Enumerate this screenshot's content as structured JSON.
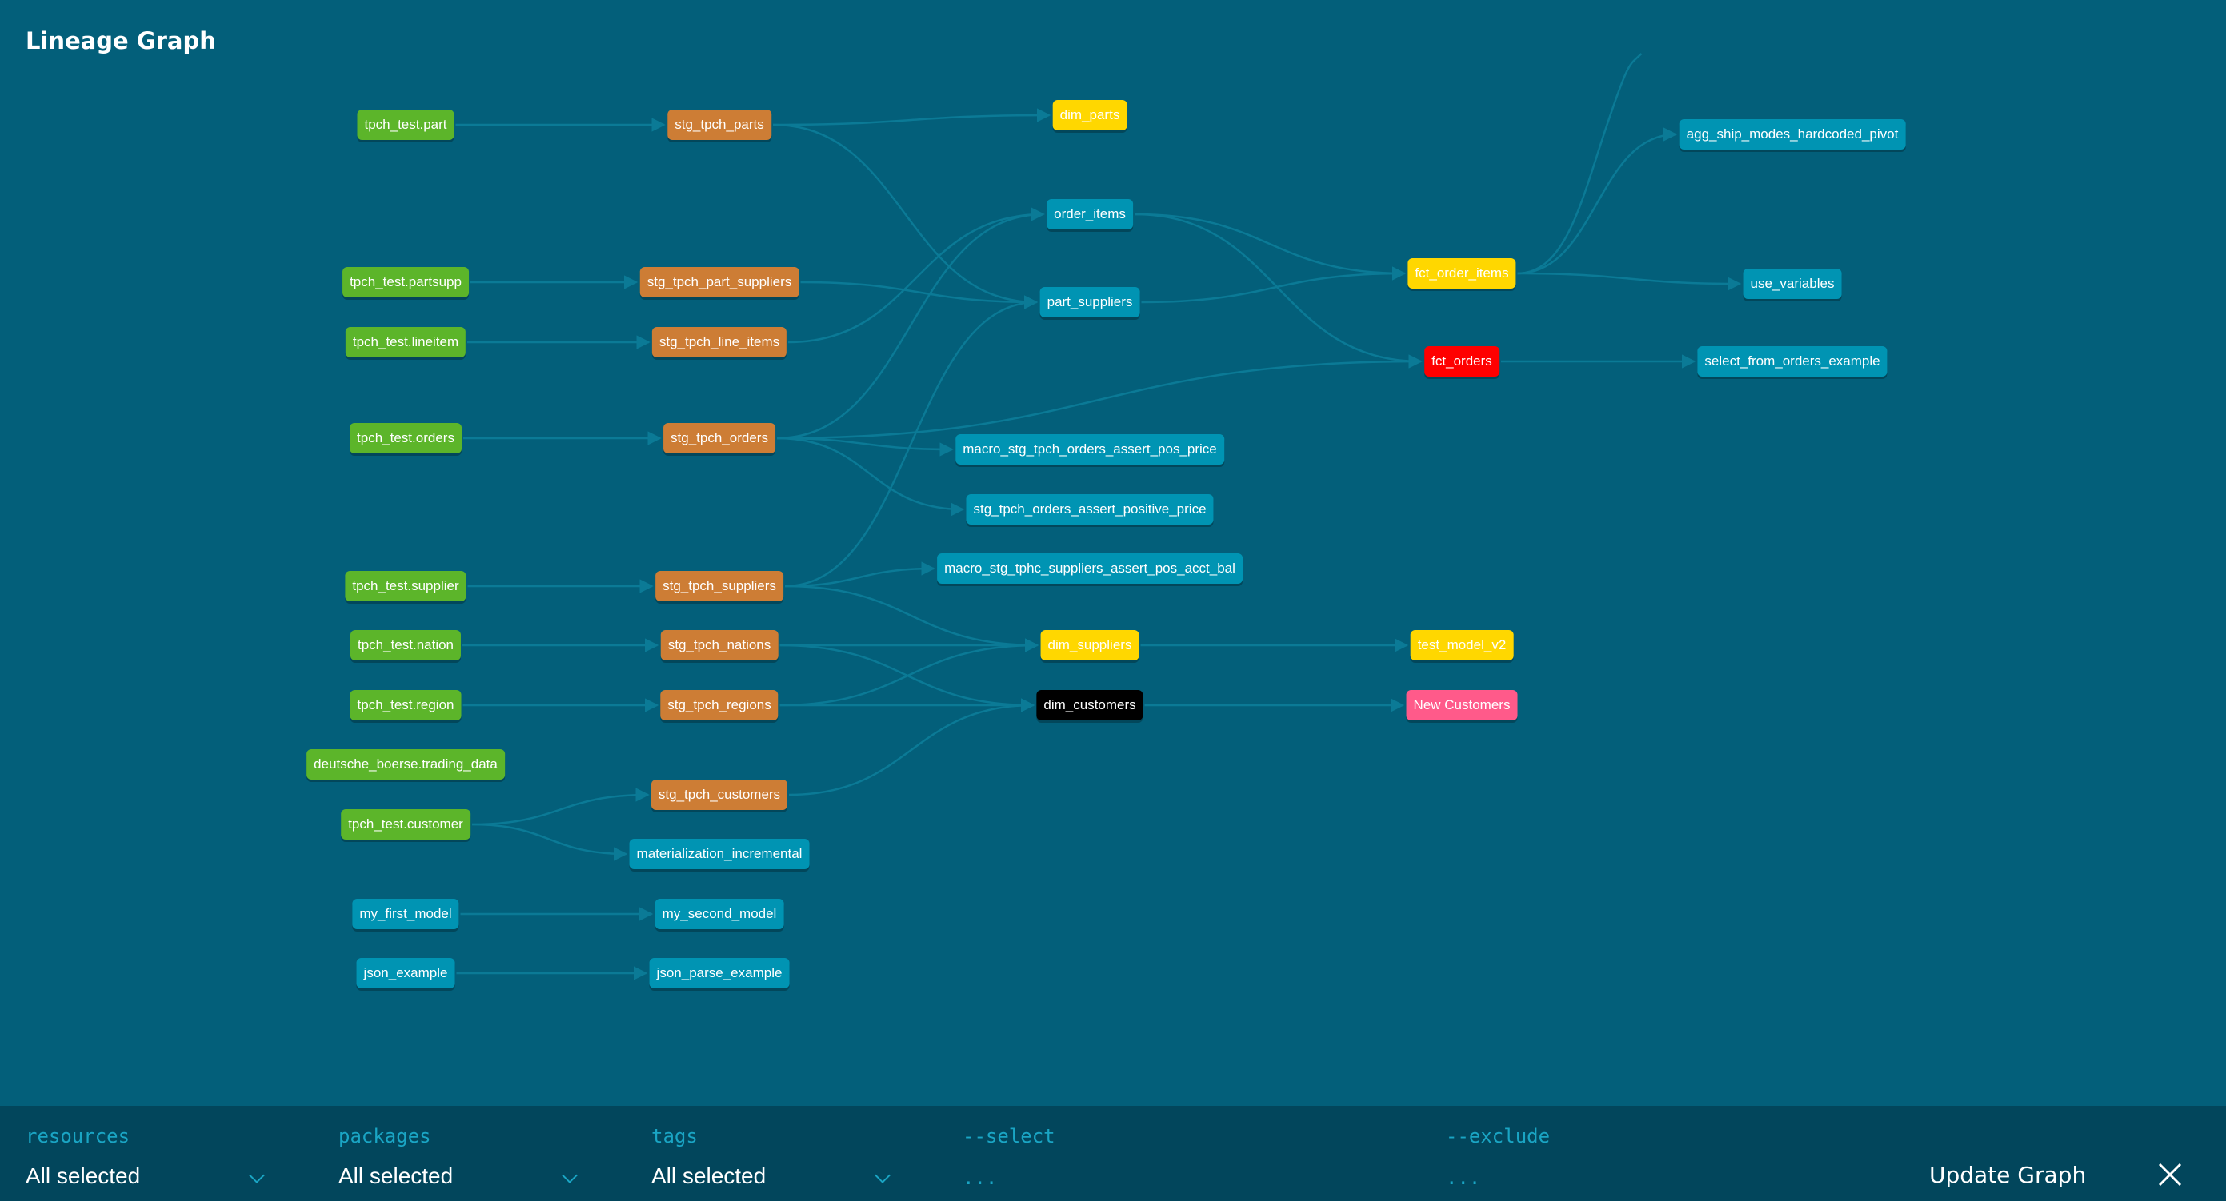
{
  "title": "Lineage Graph",
  "colors": {
    "background": "#035f7a",
    "toolbar": "#02465c",
    "edge": "#0b7a96",
    "source": "#5cb52a",
    "staging": "#cd7d35",
    "model": "#0094b3",
    "mart": "#ffd700",
    "highlight_red": "#ff0000",
    "selected_black": "#000000",
    "exposure_pink": "#ff5a8a"
  },
  "nodes": [
    {
      "id": "tpch_test.part",
      "label": "tpch_test.part",
      "type": "source"
    },
    {
      "id": "stg_tpch_parts",
      "label": "stg_tpch_parts",
      "type": "staging"
    },
    {
      "id": "dim_parts",
      "label": "dim_parts",
      "type": "mart"
    },
    {
      "id": "order_items",
      "label": "order_items",
      "type": "model"
    },
    {
      "id": "part_suppliers",
      "label": "part_suppliers",
      "type": "model"
    },
    {
      "id": "fct_order_items",
      "label": "fct_order_items",
      "type": "mart"
    },
    {
      "id": "fct_orders",
      "label": "fct_orders",
      "type": "highlight_red"
    },
    {
      "id": "agg_ship_modes_hardcoded_pivot",
      "label": "agg_ship_modes_hardcoded_pivot",
      "type": "model"
    },
    {
      "id": "use_variables",
      "label": "use_variables",
      "type": "model"
    },
    {
      "id": "select_from_orders_example",
      "label": "select_from_orders_example",
      "type": "model"
    },
    {
      "id": "tpch_test.partsupp",
      "label": "tpch_test.partsupp",
      "type": "source"
    },
    {
      "id": "stg_tpch_part_suppliers",
      "label": "stg_tpch_part_suppliers",
      "type": "staging"
    },
    {
      "id": "tpch_test.lineitem",
      "label": "tpch_test.lineitem",
      "type": "source"
    },
    {
      "id": "stg_tpch_line_items",
      "label": "stg_tpch_line_items",
      "type": "staging"
    },
    {
      "id": "tpch_test.orders",
      "label": "tpch_test.orders",
      "type": "source"
    },
    {
      "id": "stg_tpch_orders",
      "label": "stg_tpch_orders",
      "type": "staging"
    },
    {
      "id": "macro_stg_tpch_orders_assert_pos_price",
      "label": "macro_stg_tpch_orders_assert_pos_price",
      "type": "model"
    },
    {
      "id": "stg_tpch_orders_assert_positive_price",
      "label": "stg_tpch_orders_assert_positive_price",
      "type": "model"
    },
    {
      "id": "macro_stg_tphc_suppliers_assert_pos_acct_bal",
      "label": "macro_stg_tphc_suppliers_assert_pos_acct_bal",
      "type": "model"
    },
    {
      "id": "tpch_test.supplier",
      "label": "tpch_test.supplier",
      "type": "source"
    },
    {
      "id": "stg_tpch_suppliers",
      "label": "stg_tpch_suppliers",
      "type": "staging"
    },
    {
      "id": "tpch_test.nation",
      "label": "tpch_test.nation",
      "type": "source"
    },
    {
      "id": "stg_tpch_nations",
      "label": "stg_tpch_nations",
      "type": "staging"
    },
    {
      "id": "dim_suppliers",
      "label": "dim_suppliers",
      "type": "mart"
    },
    {
      "id": "test_model_v2",
      "label": "test_model_v2",
      "type": "mart"
    },
    {
      "id": "tpch_test.region",
      "label": "tpch_test.region",
      "type": "source"
    },
    {
      "id": "stg_tpch_regions",
      "label": "stg_tpch_regions",
      "type": "staging"
    },
    {
      "id": "dim_customers",
      "label": "dim_customers",
      "type": "selected_black"
    },
    {
      "id": "New Customers",
      "label": "New Customers",
      "type": "exposure_pink"
    },
    {
      "id": "deutsche_boerse.trading_data",
      "label": "deutsche_boerse.trading_data",
      "type": "source"
    },
    {
      "id": "stg_tpch_customers",
      "label": "stg_tpch_customers",
      "type": "staging"
    },
    {
      "id": "tpch_test.customer",
      "label": "tpch_test.customer",
      "type": "source"
    },
    {
      "id": "materialization_incremental",
      "label": "materialization_incremental",
      "type": "model"
    },
    {
      "id": "my_first_model",
      "label": "my_first_model",
      "type": "model"
    },
    {
      "id": "my_second_model",
      "label": "my_second_model",
      "type": "model"
    },
    {
      "id": "json_example",
      "label": "json_example",
      "type": "model"
    },
    {
      "id": "json_parse_example",
      "label": "json_parse_example",
      "type": "model"
    }
  ],
  "edges": [
    [
      "tpch_test.part",
      "stg_tpch_parts"
    ],
    [
      "stg_tpch_parts",
      "dim_parts"
    ],
    [
      "stg_tpch_parts",
      "part_suppliers"
    ],
    [
      "tpch_test.partsupp",
      "stg_tpch_part_suppliers"
    ],
    [
      "stg_tpch_part_suppliers",
      "part_suppliers"
    ],
    [
      "tpch_test.lineitem",
      "stg_tpch_line_items"
    ],
    [
      "stg_tpch_line_items",
      "order_items"
    ],
    [
      "tpch_test.orders",
      "stg_tpch_orders"
    ],
    [
      "stg_tpch_orders",
      "order_items"
    ],
    [
      "stg_tpch_orders",
      "fct_orders"
    ],
    [
      "stg_tpch_orders",
      "macro_stg_tpch_orders_assert_pos_price"
    ],
    [
      "stg_tpch_orders",
      "stg_tpch_orders_assert_positive_price"
    ],
    [
      "tpch_test.supplier",
      "stg_tpch_suppliers"
    ],
    [
      "stg_tpch_suppliers",
      "part_suppliers"
    ],
    [
      "stg_tpch_suppliers",
      "macro_stg_tphc_suppliers_assert_pos_acct_bal"
    ],
    [
      "stg_tpch_suppliers",
      "dim_suppliers"
    ],
    [
      "tpch_test.nation",
      "stg_tpch_nations"
    ],
    [
      "stg_tpch_nations",
      "dim_suppliers"
    ],
    [
      "stg_tpch_nations",
      "dim_customers"
    ],
    [
      "tpch_test.region",
      "stg_tpch_regions"
    ],
    [
      "stg_tpch_regions",
      "dim_suppliers"
    ],
    [
      "stg_tpch_regions",
      "dim_customers"
    ],
    [
      "tpch_test.customer",
      "stg_tpch_customers"
    ],
    [
      "tpch_test.customer",
      "materialization_incremental"
    ],
    [
      "stg_tpch_customers",
      "dim_customers"
    ],
    [
      "order_items",
      "fct_order_items"
    ],
    [
      "order_items",
      "fct_orders"
    ],
    [
      "part_suppliers",
      "fct_order_items"
    ],
    [
      "fct_order_items",
      "agg_ship_modes_hardcoded_pivot"
    ],
    [
      "fct_order_items",
      "use_variables"
    ],
    [
      "fct_orders",
      "select_from_orders_example"
    ],
    [
      "dim_suppliers",
      "test_model_v2"
    ],
    [
      "dim_customers",
      "New Customers"
    ],
    [
      "my_first_model",
      "my_second_model"
    ],
    [
      "json_example",
      "json_parse_example"
    ]
  ],
  "toolbar": {
    "resources": {
      "label": "resources",
      "value": "All selected"
    },
    "packages": {
      "label": "packages",
      "value": "All selected"
    },
    "tags": {
      "label": "tags",
      "value": "All selected"
    },
    "select": {
      "label": "--select",
      "placeholder": "..."
    },
    "exclude": {
      "label": "--exclude",
      "placeholder": "..."
    },
    "update_label": "Update Graph",
    "close_icon": "close-icon"
  }
}
